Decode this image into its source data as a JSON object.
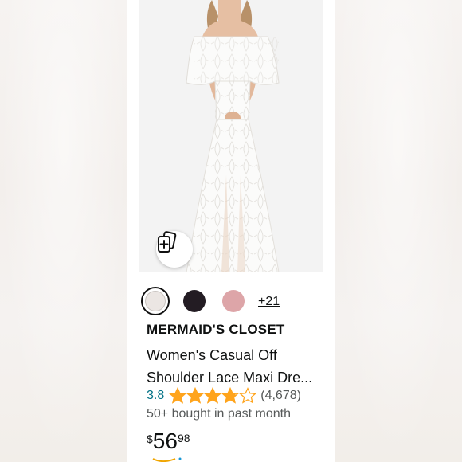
{
  "product": {
    "brand": "MERMAID'S CLOSET",
    "title_line1": "Women's Casual Off",
    "title_line2": "Shoulder Lace Maxi Dre...",
    "rating": "3.8",
    "rating_value": 3.8,
    "stars_max": 5,
    "review_count": "(4,678)",
    "bought": "50+ bought in past month",
    "price": {
      "symbol": "$",
      "whole": "56",
      "fraction": "98"
    }
  },
  "image": {
    "alt": "White off-shoulder lace maxi dress",
    "similar_icon": "view-similar-icon"
  },
  "swatches": {
    "colors": [
      {
        "name": "white",
        "hex": "#ebe6e3",
        "selected": true
      },
      {
        "name": "black",
        "hex": "#231c23",
        "selected": false
      },
      {
        "name": "pink",
        "hex": "#dda5a8",
        "selected": false
      }
    ],
    "more": "+21"
  },
  "colors": {
    "star": "#ffa41c",
    "link": "#007185",
    "text": "#0f1111",
    "muted": "#565959"
  }
}
